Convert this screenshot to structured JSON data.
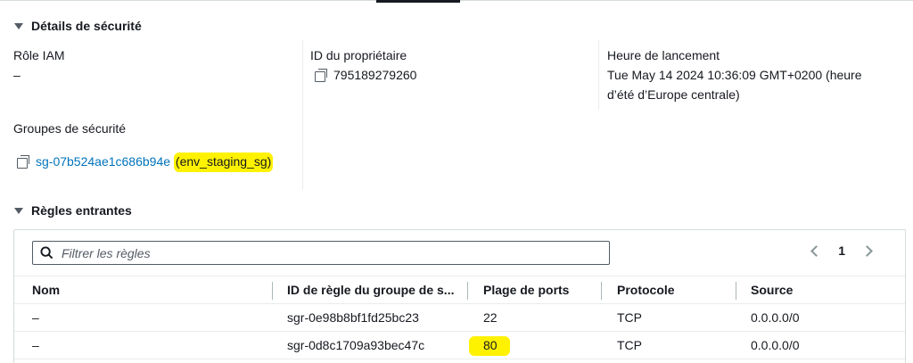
{
  "security_details": {
    "title": "Détails de sécurité",
    "iam_role": {
      "label": "Rôle IAM",
      "value": "–"
    },
    "owner_id": {
      "label": "ID du propriétaire",
      "value": "795189279260"
    },
    "launch_time": {
      "label": "Heure de lancement",
      "value_line1": "Tue May 14 2024 10:36:09 GMT+0200 (heure",
      "value_line2": "d’été d’Europe centrale)"
    },
    "security_groups": {
      "label": "Groupes de sécurité",
      "group_id": "sg-07b524ae1c686b94e",
      "group_name": "(env_staging_sg)"
    }
  },
  "inbound_rules": {
    "title": "Règles entrantes",
    "filter_placeholder": "Filtrer les règles",
    "page": "1",
    "columns": [
      "Nom",
      "ID de règle du groupe de s...",
      "Plage de ports",
      "Protocole",
      "Source"
    ],
    "rows": [
      {
        "name": "–",
        "rule_id": "sgr-0e98b8bf1fd25bc23",
        "port_range": "22",
        "protocol": "TCP",
        "source": "0.0.0.0/0"
      },
      {
        "name": "–",
        "rule_id": "sgr-0d8c1709a93bec47c",
        "port_range": "80",
        "protocol": "TCP",
        "source": "0.0.0.0/0"
      }
    ]
  },
  "colors": {
    "link": "#0073bb",
    "highlight": "#fff200",
    "text": "#16191f"
  }
}
